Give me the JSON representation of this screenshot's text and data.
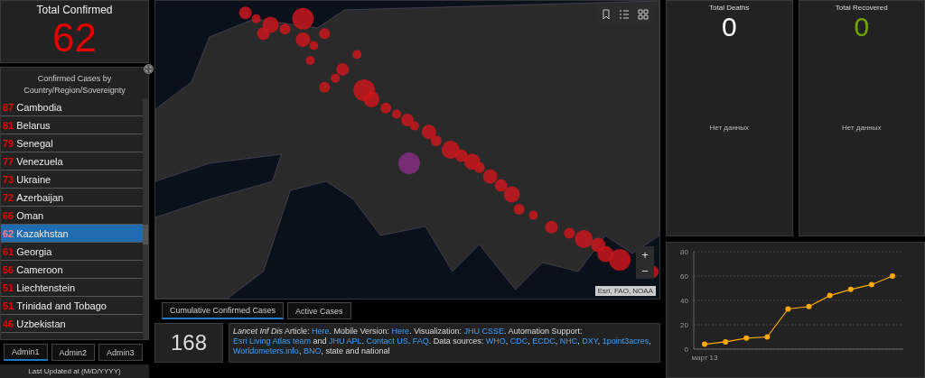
{
  "total_confirmed": {
    "title": "Total Confirmed",
    "value": "62"
  },
  "country_list": {
    "title": "Confirmed Cases by Country/Region/Sovereignty",
    "items": [
      {
        "count": "87",
        "name": "Cambodia",
        "selected": false
      },
      {
        "count": "81",
        "name": "Belarus",
        "selected": false
      },
      {
        "count": "79",
        "name": "Senegal",
        "selected": false
      },
      {
        "count": "77",
        "name": "Venezuela",
        "selected": false
      },
      {
        "count": "73",
        "name": "Ukraine",
        "selected": false
      },
      {
        "count": "72",
        "name": "Azerbaijan",
        "selected": false
      },
      {
        "count": "66",
        "name": "Oman",
        "selected": false
      },
      {
        "count": "62",
        "name": "Kazakhstan",
        "selected": true
      },
      {
        "count": "61",
        "name": "Georgia",
        "selected": false
      },
      {
        "count": "56",
        "name": "Cameroon",
        "selected": false
      },
      {
        "count": "51",
        "name": "Liechtenstein",
        "selected": false
      },
      {
        "count": "51",
        "name": "Trinidad and Tobago",
        "selected": false
      },
      {
        "count": "46",
        "name": "Uzbekistan",
        "selected": false
      }
    ]
  },
  "admin_tabs": [
    {
      "label": "Admin1",
      "selected": true
    },
    {
      "label": "Admin2",
      "selected": false
    },
    {
      "label": "Admin3",
      "selected": false
    }
  ],
  "last_updated": "Last Updated at (M/D/YYYY)",
  "map": {
    "attribution": "Esri, FAO, NOAA",
    "zoom_buttons": [
      "+",
      "−"
    ]
  },
  "map_tabs": [
    {
      "label": "Cumulative Confirmed Cases",
      "selected": true
    },
    {
      "label": "Active Cases",
      "selected": false
    }
  ],
  "info_panel": {
    "count": "168",
    "segments": [
      {
        "text": "*Lancet Inf Dis* Article: "
      },
      {
        "text": "Here",
        "link": true
      },
      {
        "text": ". Mobile Version: "
      },
      {
        "text": "Here",
        "link": true
      },
      {
        "text": ". Visualization: "
      },
      {
        "text": "JHU CSSE",
        "link": true
      },
      {
        "text": ". Automation Support: "
      },
      {
        "text": "Esri Living Atlas team",
        "link": true
      },
      {
        "text": " and "
      },
      {
        "text": "JHU APL",
        "link": true
      },
      {
        "text": ". "
      },
      {
        "text": "Contact US",
        "link": true
      },
      {
        "text": ". "
      },
      {
        "text": "FAQ",
        "link": true
      },
      {
        "text": ". Data sources: "
      },
      {
        "text": "WHO",
        "link": true
      },
      {
        "text": ", "
      },
      {
        "text": "CDC",
        "link": true
      },
      {
        "text": ", "
      },
      {
        "text": "ECDC",
        "link": true
      },
      {
        "text": ", "
      },
      {
        "text": "NHC",
        "link": true
      },
      {
        "text": ", "
      },
      {
        "text": "DXY",
        "link": true
      },
      {
        "text": ", "
      },
      {
        "text": "1point3acres",
        "link": true
      },
      {
        "text": ", "
      },
      {
        "text": "Worldometers.info",
        "link": true
      },
      {
        "text": ", "
      },
      {
        "text": "BNO",
        "link": true
      },
      {
        "text": ", state and national"
      }
    ]
  },
  "total_deaths": {
    "title": "Total Deaths",
    "value": "0",
    "note": "Нет данных"
  },
  "total_recovered": {
    "title": "Total Recovered",
    "value": "0",
    "note": "Нет данных"
  },
  "trend_chart": {
    "x_axis_label": "март 13",
    "chart_data": {
      "type": "line",
      "grid": true,
      "series": [
        {
          "color": "#ffaa00",
          "marker": true,
          "values": [
            4,
            6,
            9,
            10,
            33,
            35,
            44,
            49,
            53,
            60
          ]
        }
      ],
      "ylim": [
        0,
        80
      ],
      "yticks": [
        {
          "value": 0,
          "label": "0"
        },
        {
          "value": 20,
          "label": "20"
        },
        {
          "value": 40,
          "label": "40"
        },
        {
          "value": 60,
          "label": "60"
        },
        {
          "value": 80,
          "label": "80"
        }
      ]
    }
  }
}
